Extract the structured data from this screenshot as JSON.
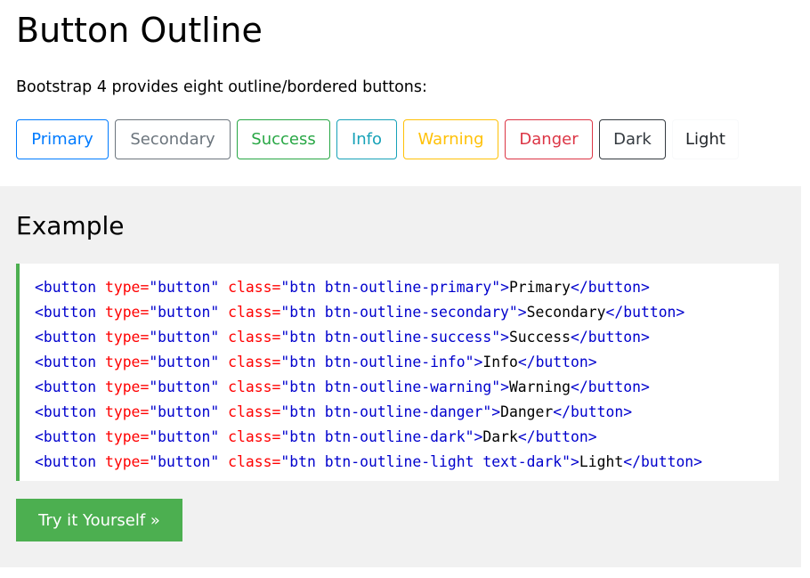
{
  "page": {
    "title": "Button Outline",
    "intro": "Bootstrap 4 provides eight outline/bordered buttons:"
  },
  "buttons": [
    {
      "label": "Primary",
      "color": "#007bff"
    },
    {
      "label": "Secondary",
      "color": "#6c757d"
    },
    {
      "label": "Success",
      "color": "#28a745"
    },
    {
      "label": "Info",
      "color": "#17a2b8"
    },
    {
      "label": "Warning",
      "color": "#ffc107"
    },
    {
      "label": "Danger",
      "color": "#dc3545"
    },
    {
      "label": "Dark",
      "color": "#343a40"
    },
    {
      "label": "Light",
      "color": "#f8f9fa"
    }
  ],
  "example": {
    "title": "Example",
    "accent_color": "#4caf50",
    "code_lines": [
      {
        "class_value": "\"btn btn-outline-primary\"",
        "text": "Primary"
      },
      {
        "class_value": "\"btn btn-outline-secondary\"",
        "text": "Secondary"
      },
      {
        "class_value": "\"btn btn-outline-success\"",
        "text": "Success"
      },
      {
        "class_value": "\"btn btn-outline-info\"",
        "text": "Info"
      },
      {
        "class_value": "\"btn btn-outline-warning\"",
        "text": "Warning"
      },
      {
        "class_value": "\"btn btn-outline-danger\"",
        "text": "Danger"
      },
      {
        "class_value": "\"btn btn-outline-dark\"",
        "text": "Dark"
      },
      {
        "class_value": "\"btn btn-outline-light text-dark\"",
        "text": "Light"
      }
    ],
    "code_tokens": {
      "open_tag": "<button",
      "type_attr": "type",
      "eq": "=",
      "type_value": "\"button\"",
      "class_attr": "class",
      "close_open": ">",
      "close_tag": "</button>"
    },
    "try_button": "Try it Yourself »"
  }
}
